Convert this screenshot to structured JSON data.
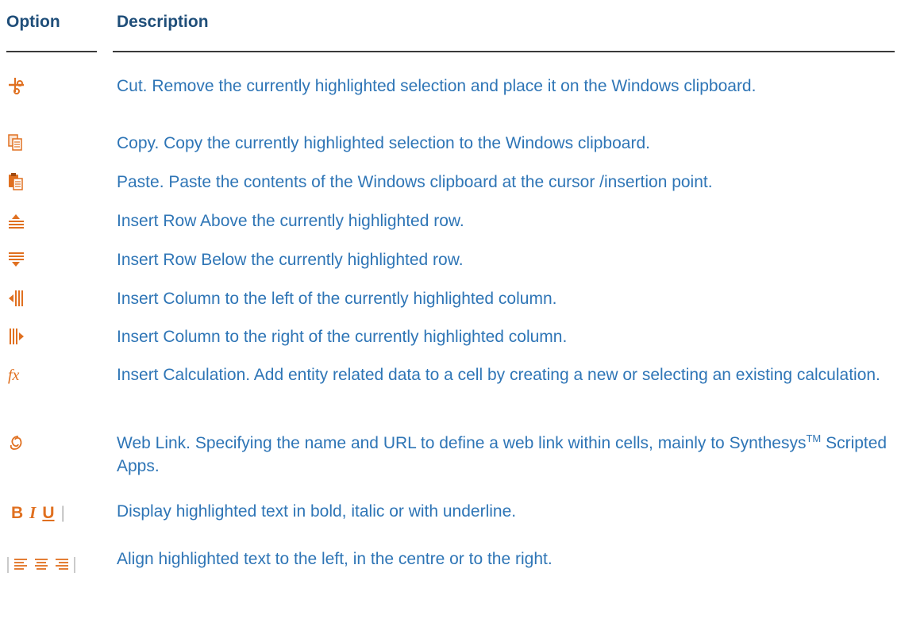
{
  "headers": {
    "option": "Option",
    "description": "Description"
  },
  "colors": {
    "header": "#1f4e79",
    "description_text": "#2e75b6",
    "icon_accent": "#e07020"
  },
  "rows": [
    {
      "icon": "scissors-icon",
      "text": "Cut. Remove the currently highlighted selection and place it on the Windows clipboard."
    },
    {
      "icon": "copy-icon",
      "text": "Copy. Copy the currently highlighted selection to the Windows clipboard."
    },
    {
      "icon": "paste-icon",
      "text": "Paste. Paste the contents of the Windows clipboard at the cursor /insertion point."
    },
    {
      "icon": "insert-row-above-icon",
      "text": "Insert Row Above the currently highlighted row."
    },
    {
      "icon": "insert-row-below-icon",
      "text": "Insert Row Below the currently highlighted row."
    },
    {
      "icon": "insert-column-left-icon",
      "text": "Insert Column to the left of the currently highlighted column."
    },
    {
      "icon": "insert-column-right-icon",
      "text": "Insert Column to the right of the currently highlighted column."
    },
    {
      "icon": "function-fx-icon",
      "text": "Insert Calculation. Add entity related data to a cell by creating a new or selecting an existing calculation."
    },
    {
      "icon": "web-link-icon",
      "text_before": "Web Link. Specifying the name and URL to define a web link within cells, mainly to Synthesys",
      "superscript": "TM",
      "text_after": " Scripted Apps."
    },
    {
      "icon": "bold-italic-underline-icon",
      "icon_labels": {
        "bold": "B",
        "italic": "I",
        "underline": "U"
      },
      "text": "Display highlighted text in bold, italic or with underline."
    },
    {
      "icon": "align-left-center-right-icon",
      "text": "Align highlighted text to the left, in the centre or to the right."
    }
  ]
}
